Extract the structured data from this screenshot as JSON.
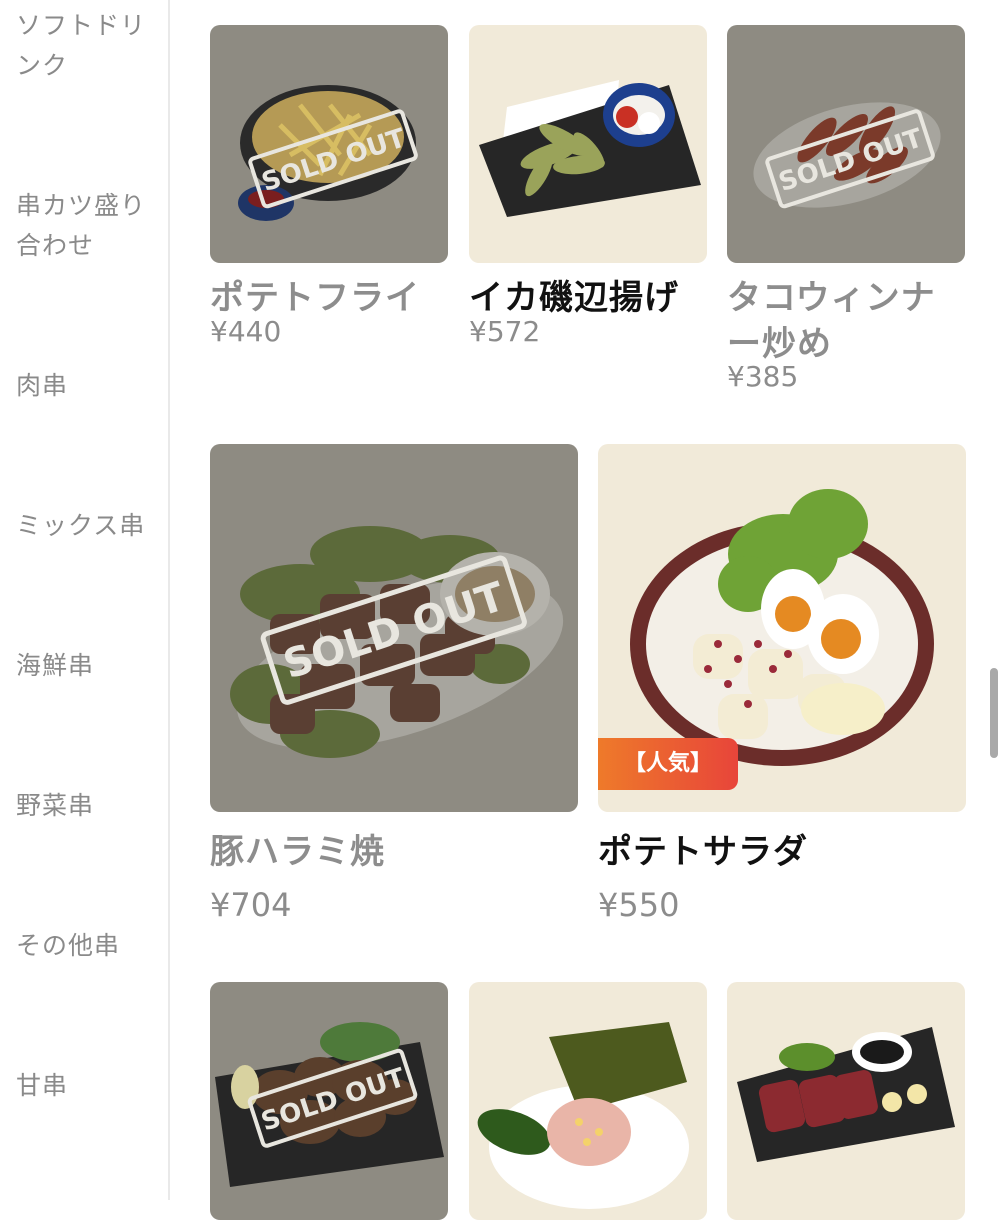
{
  "sidebar": {
    "categories": [
      {
        "label": "ソフトドリ\nンク"
      },
      {
        "label": "串カツ盛り\n合わせ"
      },
      {
        "label": "肉串"
      },
      {
        "label": "ミックス串"
      },
      {
        "label": "海鮮串"
      },
      {
        "label": "野菜串"
      },
      {
        "label": "その他串"
      },
      {
        "label": "甘串"
      }
    ]
  },
  "menu": {
    "sold_out_label": "SOLD OUT",
    "items": [
      {
        "name": "ポテトフライ",
        "price": "¥440",
        "status": "sold_out"
      },
      {
        "name": "イカ磯辺揚げ",
        "price": "¥572",
        "status": "available"
      },
      {
        "name": "タコウィンナ\nー炒め",
        "price": "¥385",
        "status": "sold_out"
      },
      {
        "name": "豚ハラミ焼",
        "price": "¥704",
        "status": "sold_out"
      },
      {
        "name": "ポテトサラダ",
        "price": "¥550",
        "status": "available",
        "badge": "【人気】"
      },
      {
        "name": "",
        "price": "",
        "status": "sold_out"
      },
      {
        "name": "",
        "price": "",
        "status": "available"
      },
      {
        "name": "",
        "price": "",
        "status": "available"
      }
    ]
  },
  "colors": {
    "sold_out_overlay": "#8e8b82",
    "badge_start": "#ee7a2a",
    "badge_end": "#e8453a"
  }
}
